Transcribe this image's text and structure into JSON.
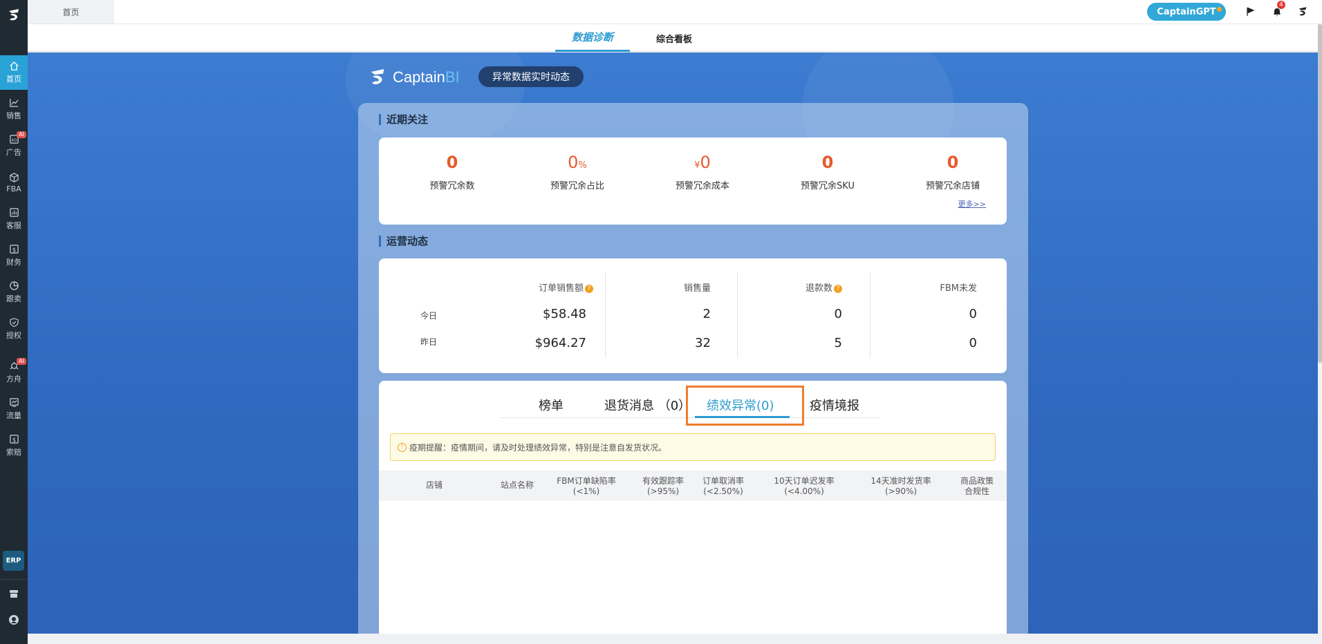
{
  "sidebar": {
    "items": [
      {
        "label": "首页",
        "icon": "home-icon",
        "active": true
      },
      {
        "label": "销售",
        "icon": "chart-line-icon"
      },
      {
        "label": "广告",
        "icon": "ad-icon",
        "badge": "AI"
      },
      {
        "label": "FBA",
        "icon": "box-icon"
      },
      {
        "label": "客服",
        "icon": "report-icon"
      },
      {
        "label": "财务",
        "icon": "dollar-icon"
      },
      {
        "label": "跟卖",
        "icon": "pie-chart-icon"
      },
      {
        "label": "授权",
        "icon": "shield-icon"
      },
      {
        "label": "方舟",
        "icon": "ark-icon",
        "badge": "AI"
      },
      {
        "label": "流量",
        "icon": "traffic-icon"
      },
      {
        "label": "索赔",
        "icon": "claim-icon"
      }
    ],
    "erp_label": "ERP"
  },
  "topbar": {
    "home_tab": "首页",
    "gpt_button": "CaptainGPT",
    "notification_count": "4"
  },
  "subnav": {
    "tabs": [
      {
        "label": "数据诊断",
        "active": true
      },
      {
        "label": "综合看板"
      }
    ]
  },
  "brand": {
    "name_part1": "Captain",
    "name_part2": "BI",
    "pill": "异常数据实时动态"
  },
  "recent": {
    "title": "近期关注",
    "kpis": [
      {
        "value": "0",
        "prefix": "",
        "suffix": "",
        "label": "预警冗余数"
      },
      {
        "value": "0",
        "prefix": "",
        "suffix": "%",
        "label": "预警冗余占比"
      },
      {
        "value": "0",
        "prefix": "¥",
        "suffix": "",
        "label": "预警冗余成本"
      },
      {
        "value": "0",
        "prefix": "",
        "suffix": "",
        "label": "预警冗余SKU"
      },
      {
        "value": "0",
        "prefix": "",
        "suffix": "",
        "label": "预警冗余店铺"
      }
    ],
    "more": "更多>>"
  },
  "operations": {
    "title": "运营动态",
    "columns": [
      "订单销售额",
      "销售量",
      "退款数",
      "FBM未发"
    ],
    "rows": [
      {
        "label": "今日",
        "values": [
          "$58.48",
          "2",
          "0",
          "0"
        ]
      },
      {
        "label": "昨日",
        "values": [
          "$964.27",
          "32",
          "5",
          "0"
        ]
      }
    ]
  },
  "performance": {
    "tabs": [
      "榜单",
      "退货消息 （0）",
      "绩效异常(0)",
      "疫情境报"
    ],
    "active_tab": 2,
    "notice": "疫期提醒：疫情期间，请及时处理绩效异常，特别是注意自发货状况。",
    "table_headers": [
      {
        "line1": "店铺",
        "line2": ""
      },
      {
        "line1": "站点名称",
        "line2": ""
      },
      {
        "line1": "FBM订单缺陷率",
        "line2": "(<1%)"
      },
      {
        "line1": "有效跟踪率",
        "line2": "(>95%)"
      },
      {
        "line1": "订单取消率",
        "line2": "(<2.50%)"
      },
      {
        "line1": "10天订单迟发率",
        "line2": "(<4.00%)"
      },
      {
        "line1": "14天准时发货率",
        "line2": "(>90%)"
      },
      {
        "line1": "商品政策",
        "line2": "合规性"
      }
    ]
  },
  "colors": {
    "accent": "#2c9bcf",
    "kpi_orange": "#e85a2b",
    "highlight_box": "#ef7d2e",
    "sidebar_bg": "#1f2a33"
  }
}
